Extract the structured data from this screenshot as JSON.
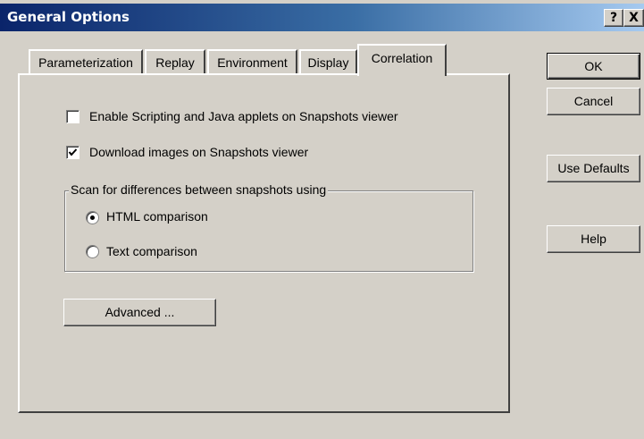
{
  "window": {
    "title": "General Options",
    "help_glyph": "?",
    "close_glyph": "X",
    "colors": {
      "titlebar_start": "#0a246a",
      "titlebar_end": "#a6caf0",
      "face": "#d4d0c8"
    }
  },
  "tabs": [
    {
      "label": "Parameterization",
      "active": false
    },
    {
      "label": "Replay",
      "active": false
    },
    {
      "label": "Environment",
      "active": false
    },
    {
      "label": "Display",
      "active": false
    },
    {
      "label": "Correlation",
      "active": true
    }
  ],
  "options": {
    "enable_scripting": {
      "label": "Enable Scripting and Java applets on Snapshots viewer",
      "checked": false
    },
    "download_images": {
      "label": "Download images on Snapshots viewer",
      "checked": true
    }
  },
  "scan_group": {
    "legend": "Scan for differences between snapshots using",
    "html": {
      "label": "HTML comparison",
      "selected": true
    },
    "text": {
      "label": "Text comparison",
      "selected": false
    }
  },
  "advanced_label": "Advanced ...",
  "buttons": {
    "ok": "OK",
    "cancel": "Cancel",
    "use_defaults": "Use Defaults",
    "help": "Help"
  }
}
